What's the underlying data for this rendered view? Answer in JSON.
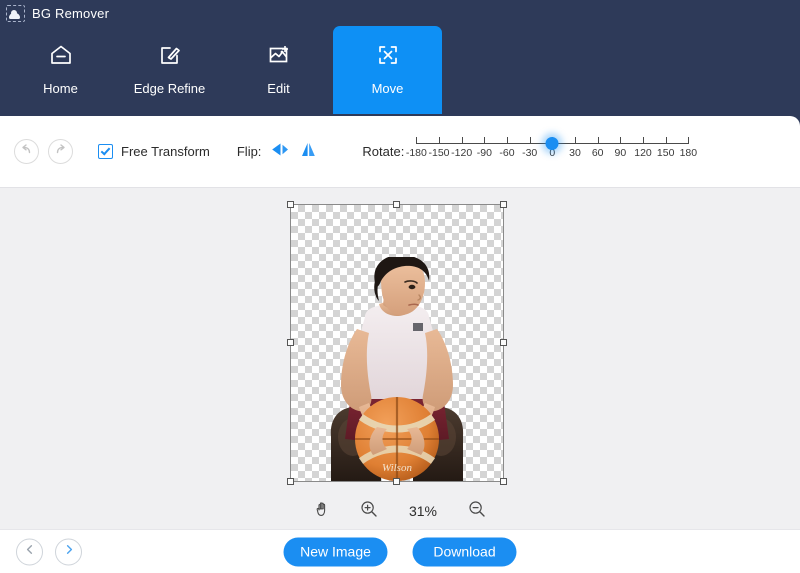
{
  "app": {
    "title": "BG Remover",
    "icon": "image-crop-icon"
  },
  "tabs": [
    {
      "label": "Home",
      "icon": "home-icon",
      "active": false
    },
    {
      "label": "Edge Refine",
      "icon": "pen-square-icon",
      "active": false
    },
    {
      "label": "Edit",
      "icon": "image-edit-icon",
      "active": false
    },
    {
      "label": "Move",
      "icon": "move-arrows-icon",
      "active": true
    }
  ],
  "toolbar": {
    "undo_icon": "undo-arrow-icon",
    "redo_icon": "redo-arrow-icon",
    "free_transform_label": "Free Transform",
    "free_transform_checked": true,
    "flip_label": "Flip:",
    "flip_horizontal_icon": "flip-horizontal-icon",
    "flip_vertical_icon": "flip-vertical-icon",
    "rotate_label": "Rotate:",
    "rotate_value": 0,
    "rotate_min": -180,
    "rotate_max": 180,
    "rotate_ticks": [
      "-180",
      "-150",
      "-120",
      "-90",
      "-60",
      "-30",
      "0",
      "30",
      "60",
      "90",
      "120",
      "150",
      "180"
    ]
  },
  "canvas": {
    "transparent_background": true,
    "selection_active": true,
    "subject_description": "person in white tank top holding a basketball"
  },
  "zoombar": {
    "hand_tool_icon": "hand-icon",
    "zoom_in_icon": "zoom-in-icon",
    "zoom_out_icon": "zoom-out-icon",
    "zoom_level": "31%"
  },
  "footer": {
    "prev_icon": "chevron-left-icon",
    "next_icon": "chevron-right-icon",
    "new_image_label": "New Image",
    "download_label": "Download"
  },
  "colors": {
    "header_bg": "#2e3a59",
    "accent": "#1b8ef2",
    "active_tab": "#0e90f5",
    "canvas_bg": "#f0f0f2"
  }
}
